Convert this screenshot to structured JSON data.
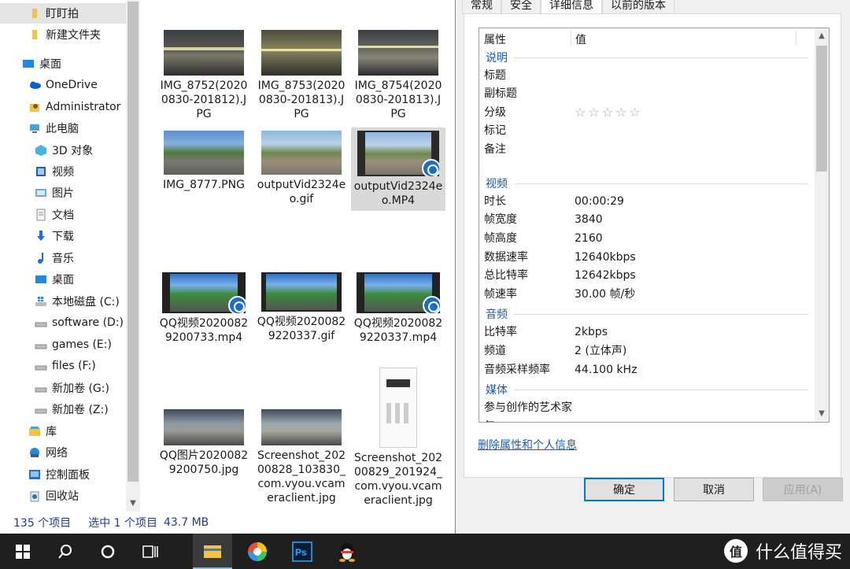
{
  "nav": {
    "items": [
      {
        "label": "盯盯拍",
        "icon": "folder-icon"
      },
      {
        "label": "新建文件夹",
        "icon": "folder-icon"
      },
      {
        "label": "桌面",
        "icon": "desktop-icon"
      },
      {
        "label": "OneDrive",
        "icon": "cloud-icon"
      },
      {
        "label": "Administrator",
        "icon": "user-folder-icon"
      },
      {
        "label": "此电脑",
        "icon": "computer-icon"
      },
      {
        "label": "3D 对象",
        "icon": "cube-icon"
      },
      {
        "label": "视频",
        "icon": "video-icon"
      },
      {
        "label": "图片",
        "icon": "pictures-icon"
      },
      {
        "label": "文档",
        "icon": "documents-icon"
      },
      {
        "label": "下载",
        "icon": "download-icon"
      },
      {
        "label": "音乐",
        "icon": "music-icon"
      },
      {
        "label": "桌面",
        "icon": "desktop-icon"
      },
      {
        "label": "本地磁盘 (C:)",
        "icon": "windows-drive-icon"
      },
      {
        "label": "software (D:)",
        "icon": "drive-icon"
      },
      {
        "label": "games (E:)",
        "icon": "drive-icon"
      },
      {
        "label": "files (F:)",
        "icon": "drive-icon"
      },
      {
        "label": "新加卷 (G:)",
        "icon": "drive-icon"
      },
      {
        "label": "新加卷 (Z:)",
        "icon": "drive-icon"
      },
      {
        "label": "库",
        "icon": "library-icon"
      },
      {
        "label": "网络",
        "icon": "network-icon"
      },
      {
        "label": "控制面板",
        "icon": "control-panel-icon"
      },
      {
        "label": "回收站",
        "icon": "recycle-bin-icon"
      }
    ]
  },
  "files": [
    {
      "name": "IMG_8752(20200830-201812).JPG",
      "kind": "image"
    },
    {
      "name": "IMG_8753(20200830-201813).JPG",
      "kind": "image"
    },
    {
      "name": "IMG_8754(20200830-201813).JPG",
      "kind": "image"
    },
    {
      "name": "IMG_8777.PNG",
      "kind": "image"
    },
    {
      "name": "outputVid2324eo.gif",
      "kind": "image"
    },
    {
      "name": "outputVid2324eo.MP4",
      "kind": "video"
    },
    {
      "name": "QQ视频20200829200733.mp4",
      "kind": "video"
    },
    {
      "name": "QQ视频20200829220337.gif",
      "kind": "video-gif"
    },
    {
      "name": "QQ视频20200829220337.mp4",
      "kind": "video"
    },
    {
      "name": "QQ图片20200829200750.jpg",
      "kind": "image"
    },
    {
      "name": "Screenshot_20200828_103830_com.vyou.vcameraclient.jpg",
      "kind": "image"
    },
    {
      "name": "Screenshot_20200829_201924_com.vyou.vcameraclient.jpg",
      "kind": "phone"
    }
  ],
  "status": {
    "count": "135 个项目",
    "selected": "选中 1 个项目",
    "size": "43.7 MB"
  },
  "dialog": {
    "tabs": [
      "常规",
      "安全",
      "详细信息",
      "以前的版本"
    ],
    "header": {
      "property": "属性",
      "value": "值"
    },
    "sections": {
      "description": "说明",
      "video": "视频",
      "audio": "音频",
      "media": "媒体"
    },
    "description_rows": {
      "title": "标题",
      "subtitle": "副标题",
      "rating": "分级",
      "rating_stars": "☆☆☆☆☆",
      "tags": "标记",
      "comments": "备注"
    },
    "video_rows": [
      {
        "key": "时长",
        "value": "00:00:29"
      },
      {
        "key": "帧宽度",
        "value": "3840"
      },
      {
        "key": "帧高度",
        "value": "2160"
      },
      {
        "key": "数据速率",
        "value": "12640kbps"
      },
      {
        "key": "总比特率",
        "value": "12642kbps"
      },
      {
        "key": "帧速率",
        "value": "30.00 帧/秒"
      }
    ],
    "audio_rows": [
      {
        "key": "比特率",
        "value": "2kbps"
      },
      {
        "key": "频道",
        "value": "2 (立体声)"
      },
      {
        "key": "音频采样频率",
        "value": "44.100 kHz"
      }
    ],
    "media_rows": {
      "artist": "参与创作的艺术家",
      "year": "年"
    },
    "remove_link": "删除属性和个人信息",
    "buttons": {
      "ok": "确定",
      "cancel": "取消",
      "apply": "应用(A)"
    }
  },
  "taskbar": {
    "watermark": "什么值得买",
    "watermark_logo": "值"
  }
}
